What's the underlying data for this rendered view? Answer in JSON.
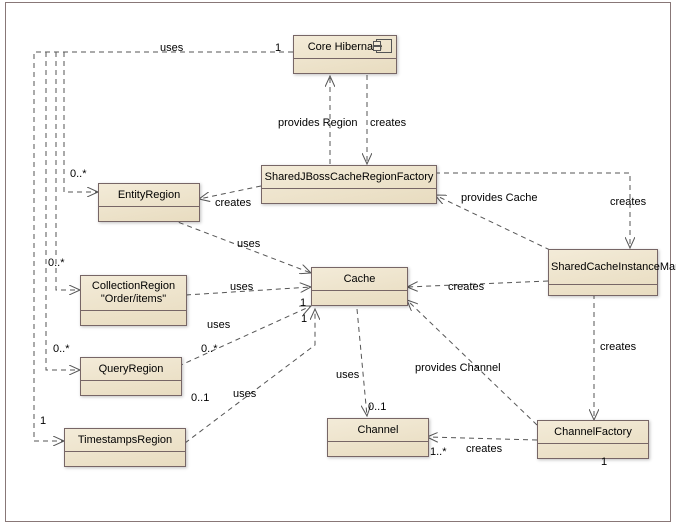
{
  "classes": {
    "core": "Core Hibernate",
    "factory": "SharedJBossCacheRegionFactory",
    "entity": "EntityRegion",
    "collection_l1": "CollectionRegion",
    "collection_l2": "\"Order/items\"",
    "query": "QueryRegion",
    "timestamps": "TimestampsRegion",
    "cache": "Cache",
    "mgr": "SharedCacheInstanceManager",
    "channel": "Channel",
    "chfactory": "ChannelFactory"
  },
  "labels": {
    "uses": "uses",
    "creates": "creates",
    "provides_region": "provides Region",
    "provides_cache": "provides Cache",
    "provides_channel": "provides Channel"
  },
  "mult": {
    "one": "1",
    "zero_star": "0..*",
    "zero_one": "0..1",
    "one_star": "1..*"
  }
}
